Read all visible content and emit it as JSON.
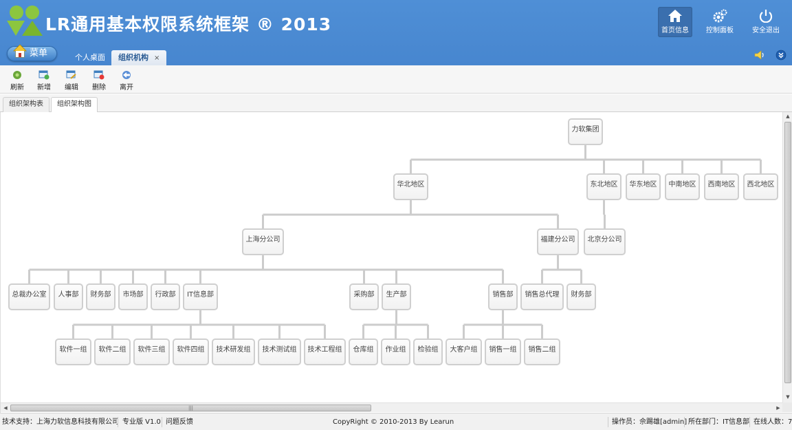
{
  "header": {
    "title": "LR通用基本权限系统框架 ® 2013",
    "top_buttons": [
      {
        "label": "首页信息",
        "icon": "home-icon",
        "active": true
      },
      {
        "label": "控制面板",
        "icon": "gears-icon",
        "active": false
      },
      {
        "label": "安全退出",
        "icon": "power-icon",
        "active": false
      }
    ],
    "menu_label": "菜单",
    "nav_tabs": [
      {
        "label": "个人桌面",
        "active": false
      },
      {
        "label": "组织机构",
        "active": true,
        "close": "×"
      }
    ]
  },
  "toolbar": {
    "refresh": "刷新",
    "add": "新增",
    "edit": "编辑",
    "delete": "删除",
    "leave": "离开"
  },
  "subtabs": [
    {
      "label": "组织架构表",
      "active": false
    },
    {
      "label": "组织架构图",
      "active": true
    }
  ],
  "org": {
    "root": "力软集团",
    "regions": [
      "华北地区",
      "东北地区",
      "华东地区",
      "中南地区",
      "西南地区",
      "西北地区"
    ],
    "branches": [
      "上海分公司",
      "福建分公司",
      "北京分公司"
    ],
    "shanghai_depts": [
      "总裁办公室",
      "人事部",
      "财务部",
      "市场部",
      "行政部",
      "IT信息部",
      "采购部",
      "生产部",
      "销售部"
    ],
    "fujian_depts": [
      "销售总代理",
      "财务部"
    ],
    "it_groups": [
      "软件一组",
      "软件二组",
      "软件三组",
      "软件四组",
      "技术研发组",
      "技术测试组",
      "技术工程组"
    ],
    "production_groups": [
      "仓库组",
      "作业组",
      "检验组"
    ],
    "sales_groups": [
      "大客户组",
      "销售一组",
      "销售二组"
    ]
  },
  "statusbar": {
    "support": "技术支持：上海力软信息科技有限公司",
    "edition": "专业版 V1.0",
    "feedback": "问题反馈",
    "copyright": "CopyRight © 2010-2013 By Learun",
    "operator": "操作员：佘踢雄[admin]",
    "department": "所在部门：IT信息部",
    "online": "在线人数：7"
  },
  "colors": {
    "header_bg": "#4a8bd3",
    "active_top_btn": "#3a6fae",
    "node_border": "#cfcfcf",
    "connector": "#cccccc"
  }
}
